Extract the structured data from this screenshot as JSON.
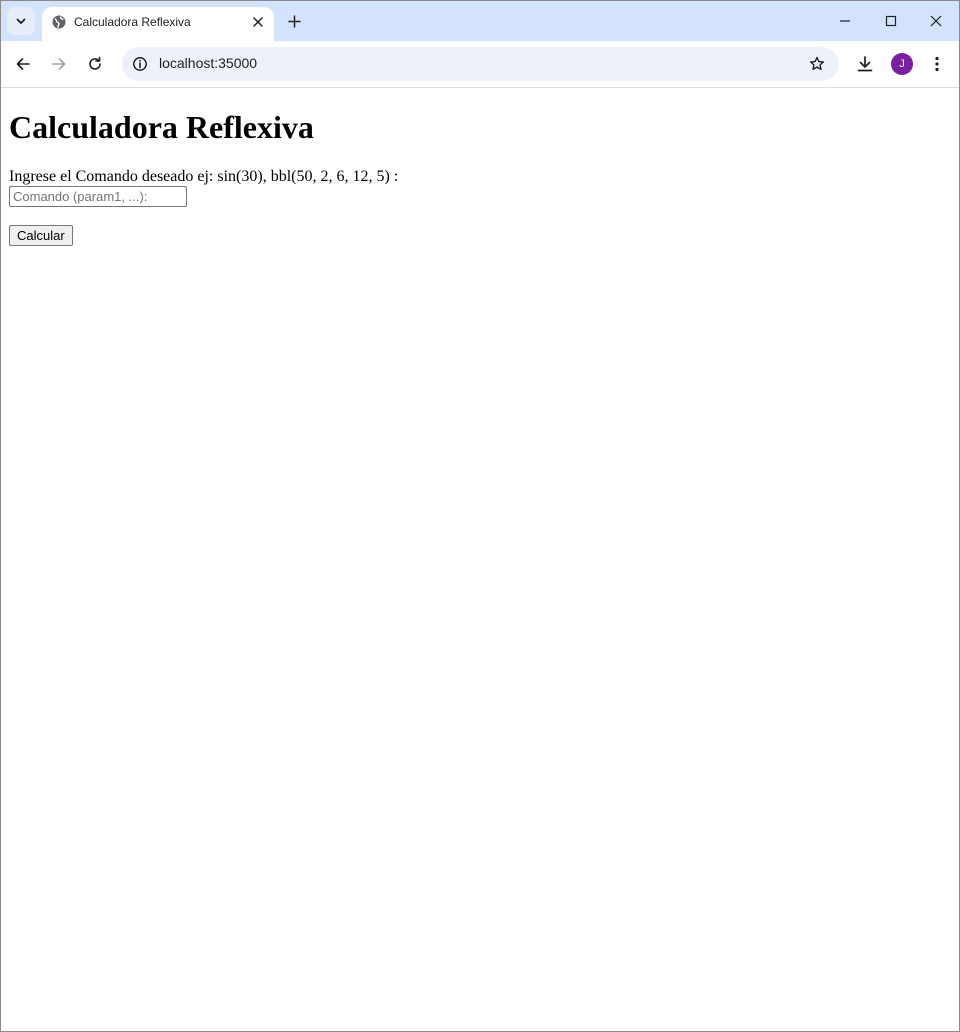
{
  "browser": {
    "tab": {
      "title": "Calculadora Reflexiva",
      "favicon": "globe-icon"
    },
    "address_bar": {
      "url": "localhost:35000"
    },
    "profile_initial": "J",
    "colors": {
      "tabstrip": "#d3e3fd",
      "omnibox": "#edf2fa",
      "avatar": "#7b1fa2"
    }
  },
  "page": {
    "heading": "Calculadora Reflexiva",
    "prompt_label": "Ingrese el Comando deseado ej: sin(30), bbl(50, 2, 6, 12, 5) :",
    "command_input": {
      "value": "",
      "placeholder": "Comando (param1, ...):"
    },
    "submit_label": "Calcular"
  }
}
